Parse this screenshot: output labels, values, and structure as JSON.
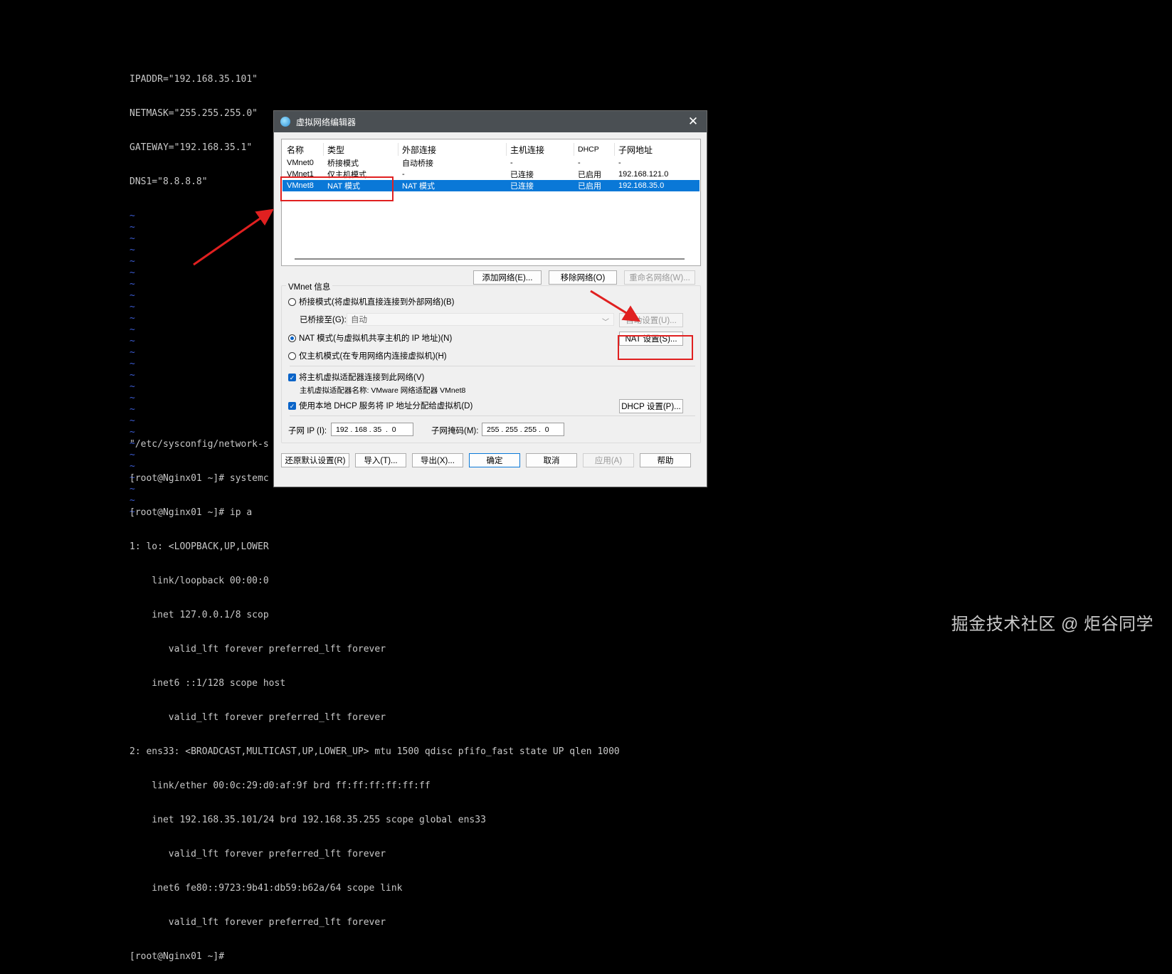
{
  "terminal": {
    "config_lines": [
      "IPADDR=\"192.168.35.101\"",
      "NETMASK=\"255.255.255.0\"",
      "GATEWAY=\"192.168.35.1\"",
      "DNS1=\"8.8.8.8\""
    ],
    "tilde": "~",
    "bottom_lines": [
      "\"/etc/sysconfig/network-s",
      "[root@Nginx01 ~]# systemc",
      "[root@Nginx01 ~]# ip a",
      "1: lo: <LOOPBACK,UP,LOWER",
      "    link/loopback 00:00:0",
      "    inet 127.0.0.1/8 scop",
      "       valid_lft forever preferred_lft forever",
      "    inet6 ::1/128 scope host",
      "       valid_lft forever preferred_lft forever",
      "2: ens33: <BROADCAST,MULTICAST,UP,LOWER_UP> mtu 1500 qdisc pfifo_fast state UP qlen 1000",
      "    link/ether 00:0c:29:d0:af:9f brd ff:ff:ff:ff:ff:ff",
      "    inet 192.168.35.101/24 brd 192.168.35.255 scope global ens33",
      "       valid_lft forever preferred_lft forever",
      "    inet6 fe80::9723:9b41:db59:b62a/64 scope link",
      "       valid_lft forever preferred_lft forever",
      "[root@Nginx01 ~]#"
    ]
  },
  "watermark": "掘金技术社区 @ 炬谷同学",
  "dialog": {
    "title": "虚拟网络编辑器",
    "close": "✕",
    "table": {
      "headers": [
        "名称",
        "类型",
        "外部连接",
        "主机连接",
        "DHCP",
        "子网地址"
      ],
      "rows": [
        [
          "VMnet0",
          "桥接模式",
          "自动桥接",
          "-",
          "-",
          "-"
        ],
        [
          "VMnet1",
          "仅主机模式",
          "-",
          "已连接",
          "已启用",
          "192.168.121.0"
        ],
        [
          "VMnet8",
          "NAT 模式",
          "NAT 模式",
          "已连接",
          "已启用",
          "192.168.35.0"
        ]
      ]
    },
    "buttons": {
      "add_network": "添加网络(E)...",
      "remove_network": "移除网络(O)",
      "rename_network": "重命名网络(W)...",
      "auto_settings": "自动设置(U)...",
      "nat_settings": "NAT 设置(S)...",
      "dhcp_settings": "DHCP 设置(P)...",
      "restore_defaults": "还原默认设置(R)",
      "import": "导入(T)...",
      "export": "导出(X)...",
      "ok": "确定",
      "cancel": "取消",
      "apply": "应用(A)",
      "help": "帮助"
    },
    "vmnet_info": {
      "label": "VMnet 信息",
      "bridged": "桥接模式(将虚拟机直接连接到外部网络)(B)",
      "bridged_to_label": "已桥接至(G):",
      "bridged_to_value": "自动",
      "nat": "NAT 模式(与虚拟机共享主机的 IP 地址)(N)",
      "host_only": "仅主机模式(在专用网络内连接虚拟机)(H)",
      "connect_adapter": "将主机虚拟适配器连接到此网络(V)",
      "adapter_name": "主机虚拟适配器名称: VMware 网络适配器 VMnet8",
      "use_dhcp": "使用本地 DHCP 服务将 IP 地址分配给虚拟机(D)",
      "subnet_ip_label": "子网 IP (I):",
      "subnet_ip_value": "192 . 168 . 35  .  0",
      "subnet_mask_label": "子网掩码(M):",
      "subnet_mask_value": "255 . 255 . 255 .  0"
    }
  },
  "colors": {
    "selection": "#0a78d7",
    "annotation": "#e02020",
    "tilde": "#3b5bd1"
  }
}
